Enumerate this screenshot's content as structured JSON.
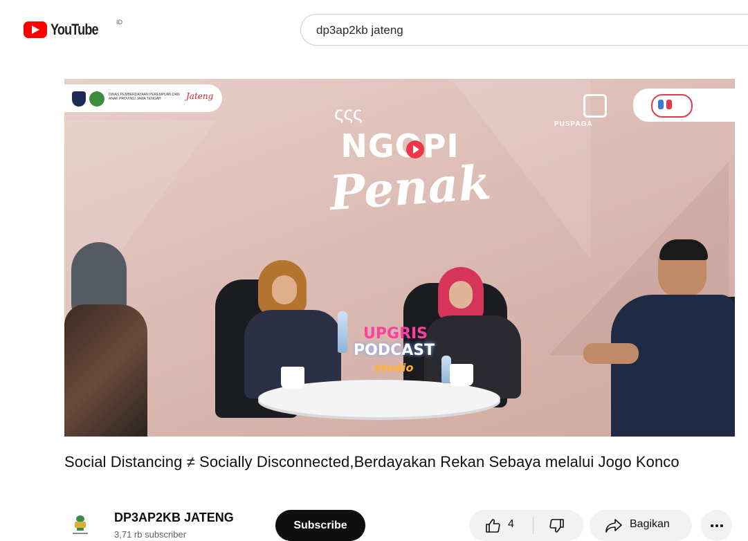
{
  "header": {
    "brand": "YouTube",
    "region": "ID",
    "search_query": "dp3ap2kb jateng"
  },
  "video": {
    "overlay": {
      "show_word": "NGOPI",
      "show_script": "Penak",
      "steam": "ςςς",
      "puspaga": "PUSPAGA",
      "partner_logo": "Jateng",
      "dept_text": "DINAS PEMBERDAYAAN PEREMPUAN DAN ANAK PROVINSI JAWA TENGAH",
      "sign_line1": "UPGRIS",
      "sign_line2": "PODCAST",
      "sign_line3": "studio"
    },
    "title": "Social Distancing ≠ Socially Disconnected,Berdayakan Rekan Sebaya melalui Jogo Konco"
  },
  "channel": {
    "name": "DP3AP2KB JATENG",
    "subscribers": "3,71 rb subscriber",
    "subscribe_label": "Subscribe"
  },
  "actions": {
    "like_count": "4",
    "share_label": "Bagikan",
    "more_label": "···"
  },
  "colors": {
    "brand_red": "#ff0000",
    "button_gray": "#f2f2f2",
    "subscribe_bg": "#0f0f0f",
    "video_bg": "#dcbcb4"
  }
}
